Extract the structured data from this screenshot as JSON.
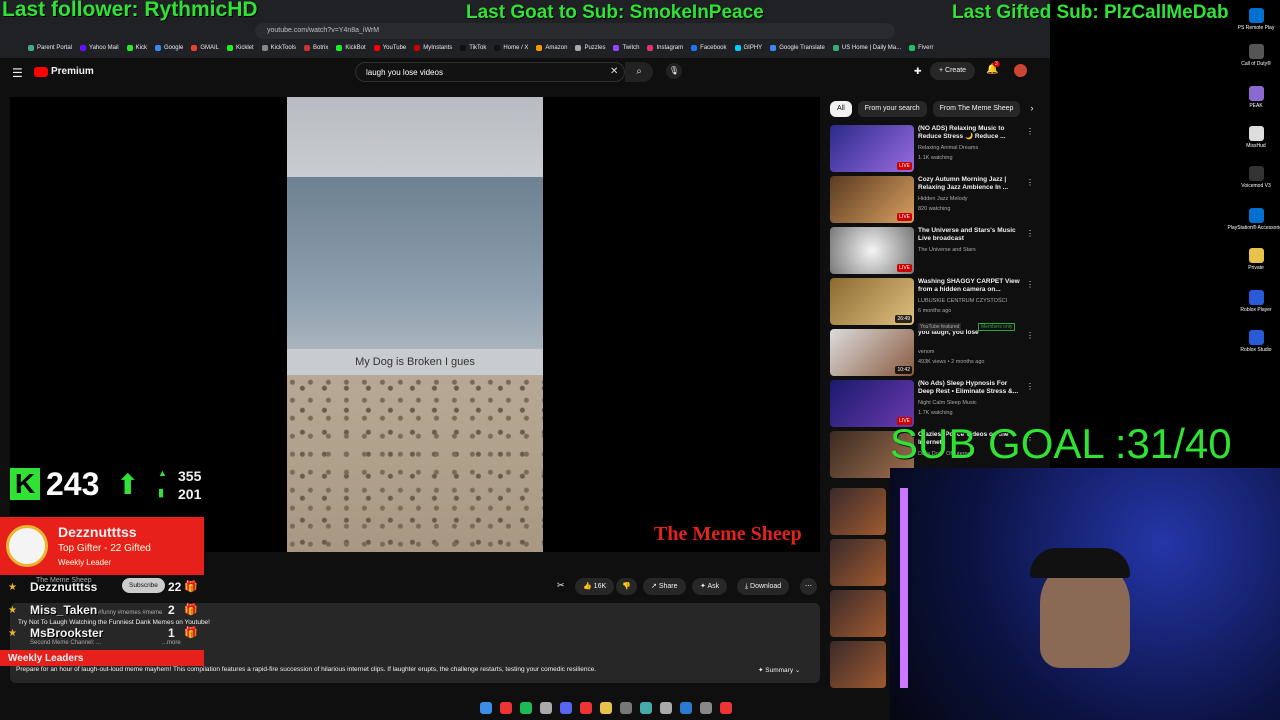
{
  "overlay": {
    "last_follower": "Last follower: RythmicHD",
    "last_goat": "Last Goat to Sub: SmokeInPeace",
    "last_gifted": "Last Gifted Sub: PlzCallMeDab",
    "sub_goal": "SUB GOAL :31/40",
    "score_main": "243",
    "score_up": "355",
    "score_bar": "201",
    "gifter_name": "Dezznutttss",
    "gifter_title": "Top Gifter - 22 Gifted",
    "gifter_sub": "Weekly Leader",
    "leaders_title": "Weekly Leaders",
    "leaders": [
      {
        "name": "Dezznutttss",
        "count": "22"
      },
      {
        "name": "Miss_Taken",
        "count": "2"
      },
      {
        "name": "MsBrookster",
        "count": "1"
      }
    ],
    "watermark": "The Meme Sheep"
  },
  "browser": {
    "url": "youtube.com/watch?v=Y4n8a_iWrM",
    "bookmarks": [
      "Parent Portal",
      "Yahoo Mail",
      "Kick",
      "Google",
      "GMAIL",
      "Kicklet",
      "KickTools",
      "Botrix",
      "KickBot",
      "YouTube",
      "MyInstants",
      "TikTok",
      "Home / X",
      "Amazon",
      "Puzzles",
      "Twitch",
      "Instagram",
      "Facebook",
      "GIPHY",
      "Google Translate",
      "US Home | Daily Ma...",
      "Fiverr"
    ]
  },
  "youtube": {
    "logo": "Premium",
    "search_value": "laugh you lose videos",
    "create_label": "Create",
    "notif_count": "3",
    "caption": "My Dog is Broken I gues",
    "likes": "16K",
    "share": "Share",
    "ask": "Ask",
    "download": "Download",
    "channel": "The Meme Sheep",
    "subscribe": "Subscribe",
    "video_title": "Try Not To Laugh Watching the Funniest Dank Memes on Youtube!",
    "tags": "#funny #memes #meme",
    "second_channel": "Second Meme Channel: ...",
    "more": "...more",
    "description": "Prepare for an hour of laugh-out-loud meme mayhem! This compilation features a rapid-fire succession of hilarious internet clips. If laughter erupts, the challenge restarts, testing your comedic resilience.",
    "summary": "Summary",
    "chips": [
      "All",
      "From your search",
      "From The Meme Sheep"
    ],
    "recs": [
      {
        "title": "(NO ADS) Relaxing Music to Reduce Stress 🌙 Reduce ...",
        "channel": "Relaxing Animal Dreams",
        "meta": "1.1K watching",
        "badge": "LIVE"
      },
      {
        "title": "Cozy Autumn Morning Jazz | Relaxing Jazz Ambience In ...",
        "channel": "Hidden Jazz Melody",
        "meta": "820 watching",
        "badge": "LIVE"
      },
      {
        "title": "The Universe and Stars's Music Live broadcast",
        "channel": "The Universe and Stars",
        "meta": "",
        "badge": "LIVE"
      },
      {
        "title": "Washing SHAGGY CARPET View from a hidden camera on...",
        "channel": "LUBUSKIE CENTRUM CZYSTOŚCI",
        "meta": "6 months ago",
        "badge": "26:49"
      },
      {
        "title": "you laugh, you lose",
        "channel": "venom",
        "meta": "493K views • 2 months ago",
        "badge": "10:42"
      },
      {
        "title": "(No Ads) Sleep Hypnosis For Deep Rest • Eliminate Stress &...",
        "channel": "Night Calm Sleep Music",
        "meta": "1.7K watching",
        "badge": "LIVE"
      },
      {
        "title": "Craziest Police Videos on the Internet",
        "channel": "Daily Dose Of Internet",
        "meta": "",
        "badge": ""
      }
    ],
    "rec_meta_extra": "YouTube featured",
    "members_only": "Members only"
  },
  "desktop": {
    "icons": [
      "PS Remote Play",
      "Call of Duty®",
      "PEAK",
      "MissHud",
      "Voicemod V3",
      "PlayStation® Accessories",
      "Private",
      "Roblox Player",
      "Roblox Studio"
    ]
  }
}
